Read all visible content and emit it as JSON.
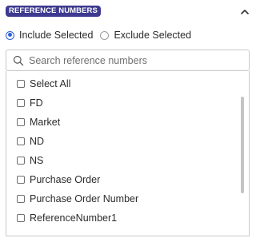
{
  "filter": {
    "title": "REFERENCE NUMBERS",
    "mode_options": [
      {
        "label": "Include Selected",
        "selected": true
      },
      {
        "label": "Exclude Selected",
        "selected": false
      }
    ],
    "search": {
      "placeholder": "Search reference numbers",
      "value": ""
    },
    "items": [
      {
        "label": "Select All",
        "checked": false
      },
      {
        "label": "FD",
        "checked": false
      },
      {
        "label": "Market",
        "checked": false
      },
      {
        "label": "ND",
        "checked": false
      },
      {
        "label": "NS",
        "checked": false
      },
      {
        "label": "Purchase Order",
        "checked": false
      },
      {
        "label": "Purchase Order Number",
        "checked": false
      },
      {
        "label": "ReferenceNumber1",
        "checked": false
      }
    ]
  },
  "icons": {
    "collapse": "chevron-up-icon",
    "search": "search-icon"
  },
  "colors": {
    "badge_background": "#3d3a8f",
    "badge_text": "#ffffff",
    "radio_selected": "#2c5fd8",
    "border": "#c9c9c9",
    "scrollbar": "#c4c4c4"
  }
}
